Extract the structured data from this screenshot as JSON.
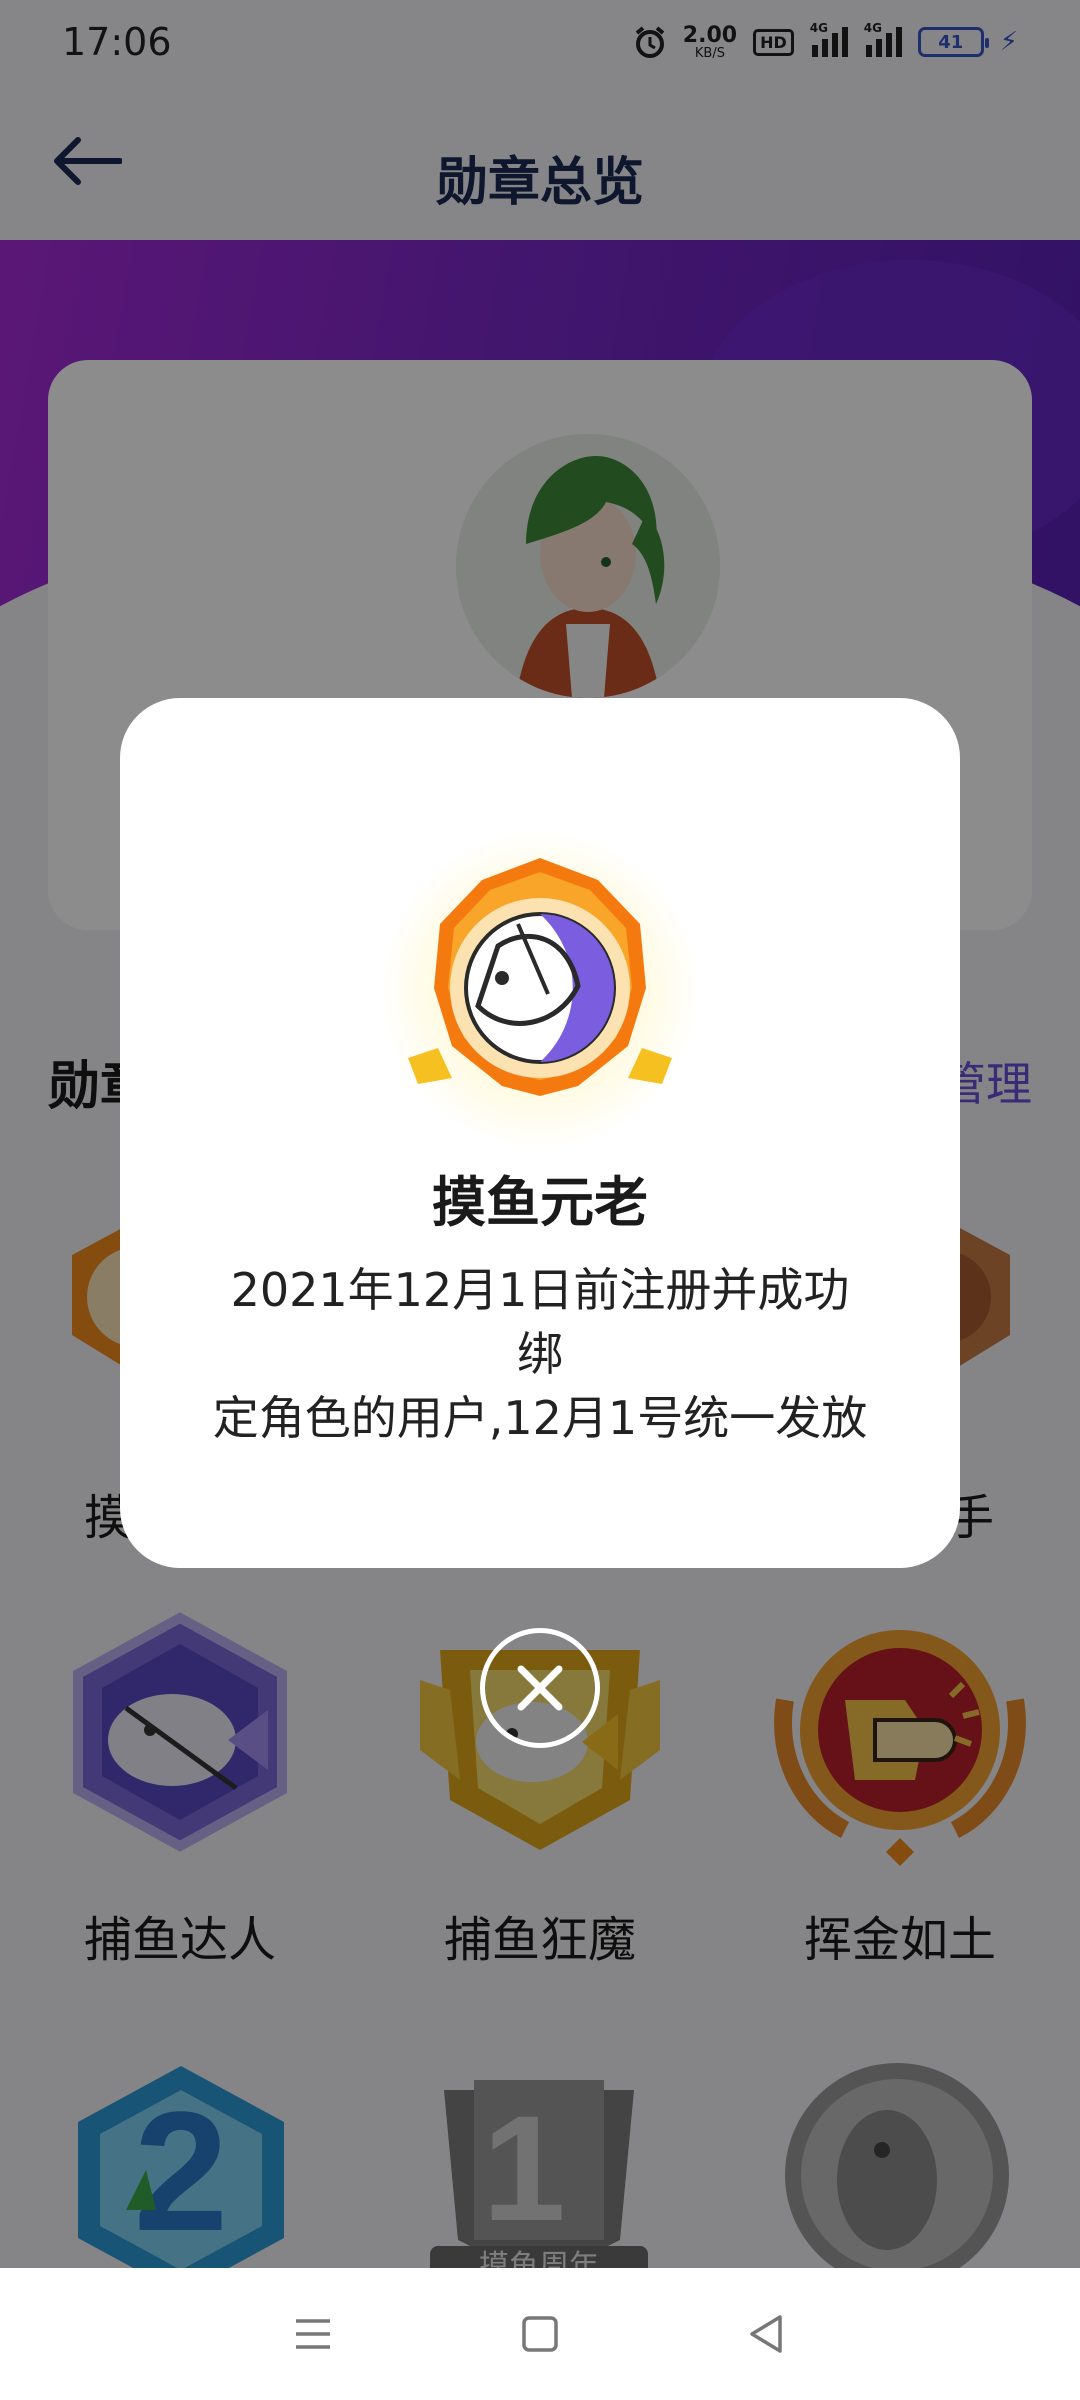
{
  "status_bar": {
    "time": "17:06",
    "net_speed": "2.00",
    "net_unit": "KB/S",
    "hd": "HD",
    "signal_label": "4G",
    "battery": "41"
  },
  "header": {
    "title": "勋章总览"
  },
  "section": {
    "title": "勋章",
    "manage": "管理"
  },
  "badges": [
    {
      "label": "捕鱼达人",
      "icon": "hexagon-fish-badge-icon"
    },
    {
      "label": "捕鱼狂魔",
      "icon": "gold-shield-fish-badge-icon"
    },
    {
      "label": "挥金如土",
      "icon": "fist-coin-badge-icon"
    }
  ],
  "partial_labels": {
    "left": "摸",
    "right": "手"
  },
  "bottom_row": [
    {
      "icon": "number-2-badge-icon"
    },
    {
      "icon": "fish-anniversary-badge-icon",
      "text": "摸鱼周年"
    },
    {
      "icon": "grey-fish-badge-icon"
    }
  ],
  "modal": {
    "title": "摸鱼元老",
    "desc_line1": "2021年12月1日前注册并成功绑",
    "desc_line2": "定角色的用户,12月1号统一发放",
    "icon": "fish-elder-badge-icon"
  },
  "nav": {
    "icons": [
      "menu-icon",
      "home-icon",
      "back-triangle-icon"
    ]
  },
  "colors": {
    "accent": "#6b4fd8",
    "band": "#8a2ad0",
    "title": "#1b2a55"
  }
}
